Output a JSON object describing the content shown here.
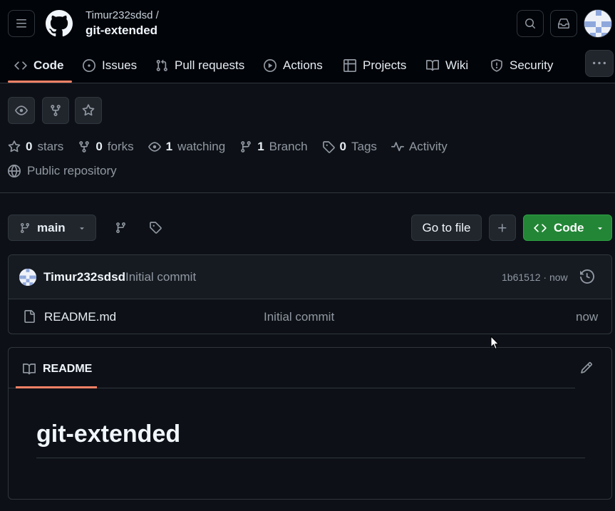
{
  "header": {
    "owner": "Timur232sdsd /",
    "repo": "git-extended",
    "icons": [
      "hamburger-icon",
      "github-logo",
      "search-icon",
      "inbox-icon",
      "avatar"
    ]
  },
  "nav": {
    "tabs": [
      {
        "label": "Code",
        "icon": "code-icon",
        "active": true
      },
      {
        "label": "Issues",
        "icon": "issue-icon"
      },
      {
        "label": "Pull requests",
        "icon": "pull-request-icon"
      },
      {
        "label": "Actions",
        "icon": "play-icon"
      },
      {
        "label": "Projects",
        "icon": "table-icon"
      },
      {
        "label": "Wiki",
        "icon": "book-icon"
      },
      {
        "label": "Security",
        "icon": "shield-icon"
      }
    ],
    "more_icon": "kebab-icon"
  },
  "repo_actions": [
    "eye-icon",
    "fork-icon",
    "star-icon"
  ],
  "stats": {
    "stars_count": "0",
    "stars_label": "stars",
    "forks_count": "0",
    "forks_label": "forks",
    "watching_count": "1",
    "watching_label": "watching",
    "branch_count": "1",
    "branch_label": "Branch",
    "tags_count": "0",
    "tags_label": "Tags",
    "activity_label": "Activity",
    "visibility": "Public repository"
  },
  "toolbar": {
    "branch": "main",
    "go_to_file": "Go to file",
    "code_label": "Code"
  },
  "commit": {
    "author": "Timur232sdsd",
    "message": "Initial commit",
    "meta": "1b61512 · now"
  },
  "files": [
    {
      "name": "README.md",
      "commit": "Initial commit",
      "time": "now"
    }
  ],
  "readme": {
    "tab_label": "README",
    "heading": "git-extended"
  },
  "colors": {
    "background": "#0d1117",
    "header_bg": "#010409",
    "accent_underline": "#f78166",
    "code_button": "#238636",
    "muted_text": "#9198a1"
  }
}
